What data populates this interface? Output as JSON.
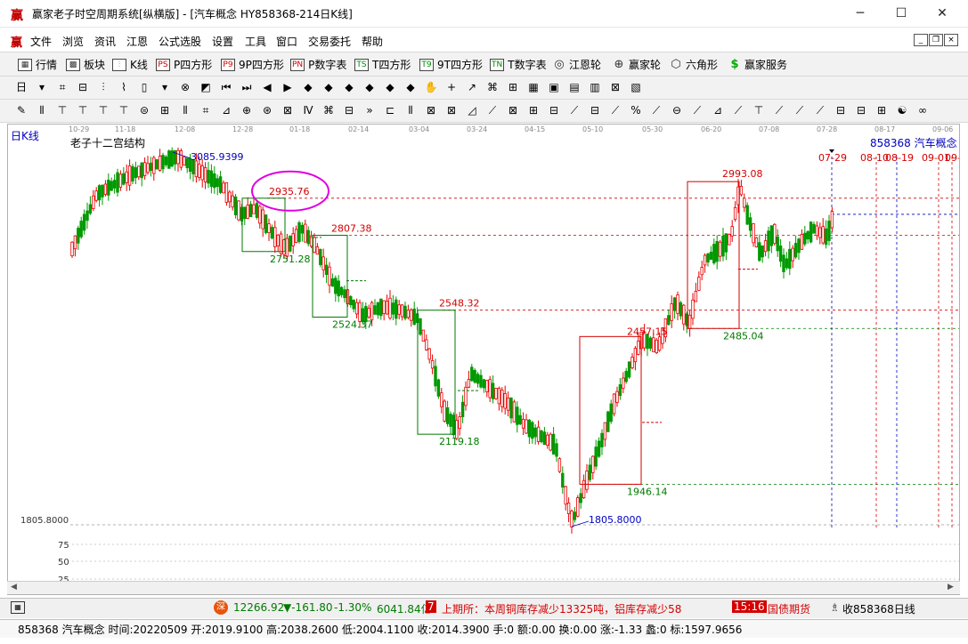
{
  "window": {
    "title": "赢家老子时空周期系统[纵横版] - [汽车概念  HY858368-214日K线]",
    "logo": "赢",
    "minimize": "─",
    "maximize": "☐",
    "close": "✕"
  },
  "menu": {
    "logo": "赢",
    "items": [
      "文件",
      "浏览",
      "资讯",
      "江恩",
      "公式选股",
      "设置",
      "工具",
      "窗口",
      "交易委托",
      "帮助"
    ],
    "mdi": [
      "_",
      "❐",
      "×"
    ]
  },
  "toolbar1": {
    "items": [
      {
        "label": "行情",
        "icon": "▦"
      },
      {
        "label": "板块",
        "icon": "▩"
      },
      {
        "label": "K线",
        "icon": "⫶"
      },
      {
        "label": "P四方形",
        "icon": "PS"
      },
      {
        "label": "9P四方形",
        "icon": "P9"
      },
      {
        "label": "P数字表",
        "icon": "PN"
      },
      {
        "label": "T四方形",
        "icon": "TS"
      },
      {
        "label": "9T四方形",
        "icon": "T9"
      },
      {
        "label": "T数字表",
        "icon": "TN"
      },
      {
        "label": "江恩轮",
        "icon": "◎"
      },
      {
        "label": "赢家轮",
        "icon": "⊕"
      },
      {
        "label": "六角形",
        "icon": "⬡"
      },
      {
        "label": "赢家服务",
        "icon": "$"
      }
    ]
  },
  "toolbar2": {
    "icons": [
      "日",
      "▾",
      "⌗",
      "⊟",
      "⫶",
      "⌇",
      "▯",
      "▾",
      "⊗",
      "◩",
      "⏮",
      "⏭",
      "◀",
      "▶",
      "◆",
      "◆",
      "◆",
      "◆",
      "◆",
      "◆",
      "✋",
      "+",
      "↗",
      "⌘",
      "⊞",
      "▦",
      "▣",
      "▤",
      "▥",
      "⊠",
      "▧"
    ]
  },
  "toolbar3": {
    "icons": [
      "✎",
      "⫴",
      "⊤",
      "⊤",
      "⊤",
      "⊤",
      "⊜",
      "⊞",
      "⫴",
      "⌗",
      "⊿",
      "⊕",
      "⊛",
      "⊠",
      "Ⅳ",
      "⌘",
      "⊟",
      "»",
      "⊏",
      "⫴",
      "⊠",
      "⊠",
      "◿",
      "⟋",
      "⊠",
      "⊞",
      "⊟",
      "⟋",
      "⊟",
      "⟋",
      "%",
      "⟋",
      "⊖",
      "⟋",
      "⊿",
      "⟋",
      "⊤",
      "⟋",
      "⟋",
      "⟋",
      "⊟",
      "⊟",
      "⊞",
      "☯",
      "∞"
    ]
  },
  "chart": {
    "period_label": "日K线",
    "indicator_name": "老子十二宫结构",
    "security": "858368 汽车概念",
    "date_ticks": [
      "10-29",
      "11-18",
      "12-08",
      "12-28",
      "01-18",
      "02-14",
      "03-04",
      "03-24",
      "04-15",
      "05-10",
      "05-30",
      "06-20",
      "07-08",
      "07-28",
      "08-17",
      "09-06"
    ],
    "future_dates": [
      "07-29",
      "08-10",
      "08-19",
      "09-01",
      "09-"
    ],
    "price_axis_low": "1805.8000",
    "sub_axis_ticks": [
      "75",
      "50",
      "25"
    ],
    "annotations": {
      "high_left": "3085.9399",
      "circled": "2935.76",
      "l1": "2751.28",
      "r1": "2807.38",
      "l2": "2524.37",
      "r2": "2548.32",
      "l3": "2119.18",
      "low": "1805.8000",
      "r3": "2457.15",
      "l4": "1946.14",
      "high_right": "2993.08",
      "l5": "2485.04"
    }
  },
  "status1": {
    "index_value": "12266.92",
    "change": "▼-161.80",
    "pct": "-1.30%",
    "volume": "6041.84亿",
    "news_tag": "7",
    "news": "上期所：本周铜库存减少13325吨，铝库存减少58",
    "time": "15:16",
    "news2": "国债期货",
    "right_label": "收858368日线"
  },
  "status2": {
    "text": "858368 汽车概念 时间:20220509 开:2019.9100 高:2038.2600 低:2004.1100 收:2014.3900 手:0 额:0.00 换:0.00 涨:-1.33 蠡:0 标:1597.9656"
  },
  "colors": {
    "up": "#e60000",
    "down": "#009900",
    "support": "#007a00",
    "resistance": "#d40000",
    "blue": "#0000c0",
    "circle": "#e000e0"
  }
}
